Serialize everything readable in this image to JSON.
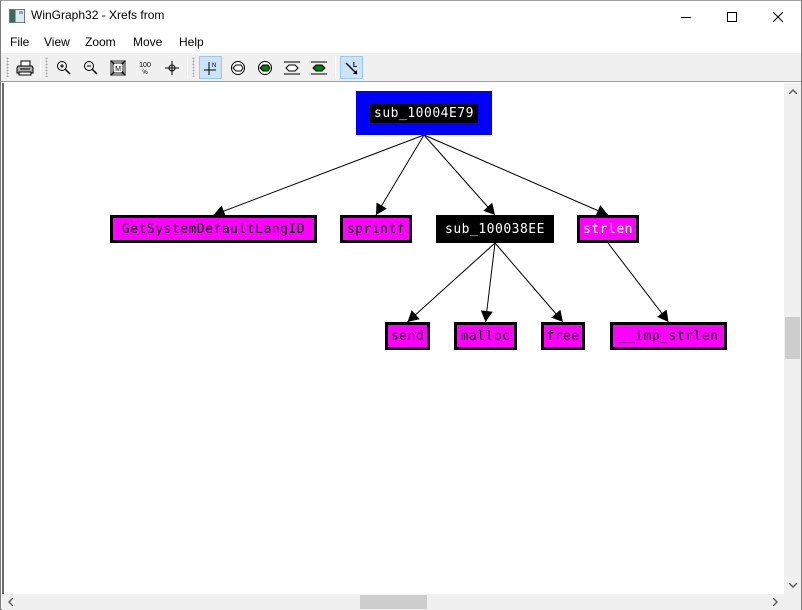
{
  "window": {
    "title": "WinGraph32 - Xrefs from",
    "controls": {
      "minimize": "minimize",
      "maximize": "maximize",
      "close": "close"
    }
  },
  "menu": {
    "items": [
      "File",
      "View",
      "Zoom",
      "Move",
      "Help"
    ]
  },
  "toolbar": {
    "groups": [
      [
        "print-icon"
      ],
      [
        "zoom-in-icon",
        "zoom-out-icon",
        "fit-window-icon",
        "zoom-100-icon",
        "center-icon"
      ],
      [
        "north-mode-icon",
        "graph-layout-icon",
        "graph-layout-filled-icon",
        "layout-boxed-icon",
        "layout-boxed-filled-icon"
      ],
      [
        "line-mode-icon"
      ]
    ],
    "active": [
      "north-mode-icon",
      "line-mode-icon"
    ],
    "zoom_100_label": "100",
    "zoom_100_sub": "%%"
  },
  "graph": {
    "colors": {
      "root_bg": "#0000ff",
      "function_bg": "#000000",
      "library_bg": "#ff00ff",
      "edge": "#000000"
    },
    "nodes": [
      {
        "id": "root",
        "label": "sub_10004E79",
        "kind": "root"
      },
      {
        "id": "n1",
        "label": "GetSystemDefaultLangID",
        "kind": "lib"
      },
      {
        "id": "n2",
        "label": "sprintf",
        "kind": "lib"
      },
      {
        "id": "n3",
        "label": "sub_100038EE",
        "kind": "fn"
      },
      {
        "id": "n4",
        "label": "strlen",
        "kind": "lib"
      },
      {
        "id": "n5",
        "label": "send",
        "kind": "lib"
      },
      {
        "id": "n6",
        "label": "malloc",
        "kind": "lib"
      },
      {
        "id": "n7",
        "label": "free",
        "kind": "lib"
      },
      {
        "id": "n8",
        "label": "__imp_strlen",
        "kind": "lib"
      }
    ],
    "edges": [
      {
        "from": "root",
        "to": "n1"
      },
      {
        "from": "root",
        "to": "n2"
      },
      {
        "from": "root",
        "to": "n3"
      },
      {
        "from": "root",
        "to": "n4"
      },
      {
        "from": "n3",
        "to": "n5"
      },
      {
        "from": "n3",
        "to": "n6"
      },
      {
        "from": "n3",
        "to": "n7"
      },
      {
        "from": "n4",
        "to": "n8"
      }
    ]
  },
  "scrollbars": {
    "vertical_position": 0.5,
    "horizontal_position": 0.45
  }
}
